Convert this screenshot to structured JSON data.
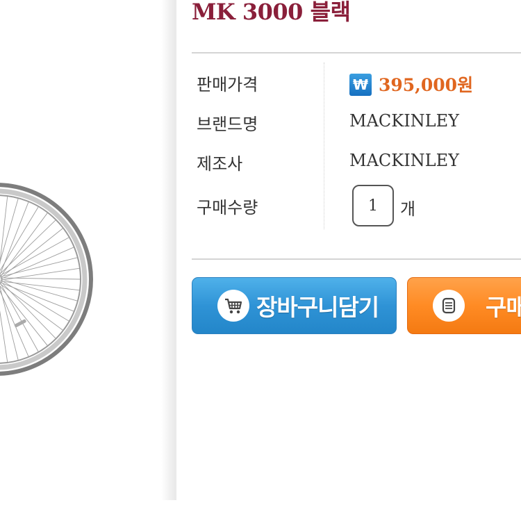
{
  "product": {
    "title": "MK 3000 블랙"
  },
  "info": {
    "price_label": "판매가격",
    "price_icon": "₩",
    "price_value": "395,000원",
    "brand_label": "브랜드명",
    "brand_value": "MACKINLEY",
    "maker_label": "제조사",
    "maker_value": "MACKINLEY",
    "qty_label": "구매수량",
    "qty_value": "1",
    "qty_unit": "개"
  },
  "buttons": {
    "cart_label": "장바구니담기",
    "buy_label": "구매"
  },
  "colors": {
    "title": "#8a1f3a",
    "price": "#e0661f",
    "cart_button": "#2f93d6",
    "buy_button": "#ff8b24"
  },
  "icons": {
    "price": "won-icon",
    "cart": "cart-icon",
    "buy": "list-icon"
  }
}
